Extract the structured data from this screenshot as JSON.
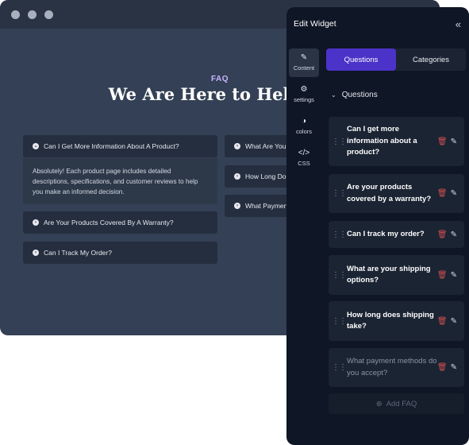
{
  "browser": {
    "faq_label": "FAQ",
    "title": "We Are Here to Help",
    "left_items": [
      {
        "label": "Can I Get More Information About A Product?"
      },
      {
        "label": "Are Your Products Covered By A Warranty?"
      },
      {
        "label": "Can I Track My Order?"
      }
    ],
    "answer": "Absolutely! Each product page includes detailed descriptions, specifications, and customer reviews to help you make an informed decision.",
    "right_items": [
      {
        "label": "What Are Your"
      },
      {
        "label": "How Long Do"
      },
      {
        "label": "What Paymen"
      }
    ]
  },
  "panel": {
    "title": "Edit Widget",
    "nav": [
      {
        "label": "Content",
        "icon": "edit-icon"
      },
      {
        "label": "settings",
        "icon": "gear-icon"
      },
      {
        "label": "colors",
        "icon": "palette-icon"
      },
      {
        "label": "CSS",
        "icon": "code-icon"
      }
    ],
    "tabs": [
      "Questions",
      "Categories"
    ],
    "section_label": "Questions",
    "questions": [
      {
        "text": "Can I get more information about a product?"
      },
      {
        "text": "Are your products covered by a warranty?"
      },
      {
        "text": "Can I track my order?"
      },
      {
        "text": "What are your shipping options?"
      },
      {
        "text": "How long does shipping take?"
      },
      {
        "text": "What payment methods do you accept?"
      }
    ],
    "add_label": "Add FAQ"
  },
  "colors": {
    "accent": "#4b32c8",
    "panel_bg": "#0f1625",
    "page_bg": "#344055",
    "delete": "#d04f4f"
  }
}
